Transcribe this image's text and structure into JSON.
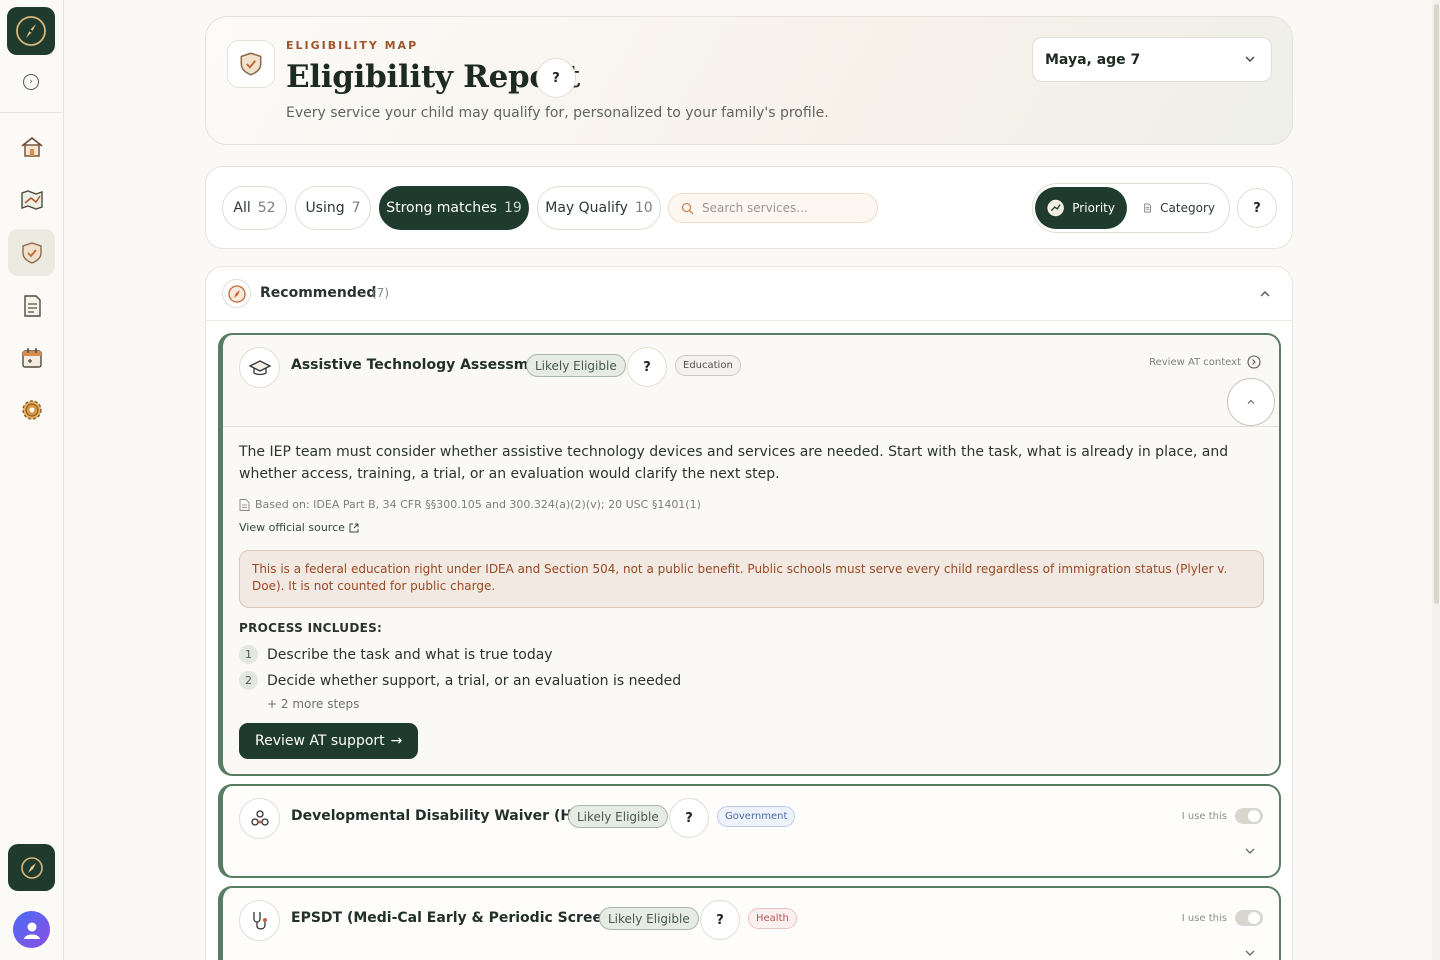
{
  "header": {
    "eyebrow": "ELIGIBILITY MAP",
    "title": "Eligibility Report",
    "help": "?",
    "subtitle": "Every service your child may qualify for, personalized to your family's profile.",
    "child_selector": "Maya, age 7"
  },
  "filters": [
    {
      "label": "All",
      "count": "52"
    },
    {
      "label": "Using",
      "count": "7"
    },
    {
      "label": "Strong matches",
      "count": "19"
    },
    {
      "label": "May Qualify",
      "count": "10"
    }
  ],
  "search": {
    "placeholder": "Search services..."
  },
  "view_toggle": {
    "priority": "Priority",
    "category": "Category",
    "help": "?"
  },
  "section": {
    "title": "Recommended",
    "count": "(7)"
  },
  "cards": [
    {
      "title": "Assistive Technology Assessment",
      "badge": "Likely Eligible",
      "help": "?",
      "category": "Education",
      "review_context": "Review AT context",
      "description": "The IEP team must consider whether assistive technology devices and services are needed. Start with the task, what is already in place, and whether access, training, a trial, or an evaluation would clarify the next step.",
      "based_on": "Based on: IDEA Part B, 34 CFR §§300.105 and 300.324(a)(2)(v); 20 USC §1401(1)",
      "source_link": "View official source",
      "notice": "This is a federal education right under IDEA and Section 504, not a public benefit. Public schools must serve every child regardless of immigration status (Plyler v. Doe). It is not counted for public charge.",
      "process_label": "PROCESS INCLUDES:",
      "steps": [
        {
          "num": "1",
          "text": "Describe the task and what is true today"
        },
        {
          "num": "2",
          "text": "Decide whether support, a trial, or an evaluation is needed"
        }
      ],
      "more_steps": "+ 2 more steps",
      "cta": "Review AT support"
    },
    {
      "title": "Developmental Disability Waiver (HCBS)",
      "badge": "Likely Eligible",
      "help": "?",
      "category": "Government",
      "use_label": "I use this"
    },
    {
      "title": "EPSDT (Medi-Cal Early & Periodic Screening)",
      "badge": "Likely Eligible",
      "help": "?",
      "category": "Health",
      "use_label": "I use this"
    }
  ],
  "colors": {
    "brand_dark": "#1f3b2d",
    "accent_orange": "#a0552b",
    "card_border": "#587d63"
  }
}
